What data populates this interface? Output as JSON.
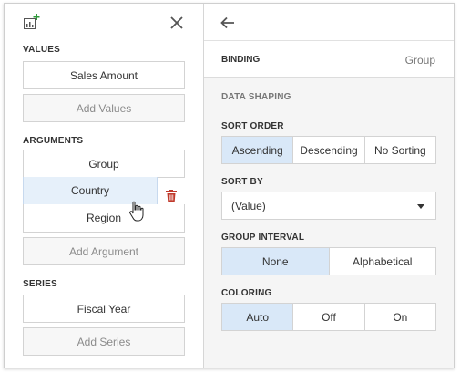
{
  "left": {
    "values_title": "VALUES",
    "values_item": "Sales Amount",
    "add_values": "Add Values",
    "arguments_title": "ARGUMENTS",
    "arguments": [
      "Group",
      "Country",
      "Region"
    ],
    "add_argument": "Add Argument",
    "series_title": "SERIES",
    "series_item": "Fiscal Year",
    "add_series": "Add Series"
  },
  "right": {
    "binding_label": "BINDING",
    "binding_value": "Group",
    "data_shaping": "DATA SHAPING",
    "sort_order_title": "SORT ORDER",
    "sort_order": [
      "Ascending",
      "Descending",
      "No Sorting"
    ],
    "sort_by_title": "SORT BY",
    "sort_by_value": "(Value)",
    "group_interval_title": "GROUP INTERVAL",
    "group_interval": [
      "None",
      "Alphabetical"
    ],
    "coloring_title": "COLORING",
    "coloring": [
      "Auto",
      "Off",
      "On"
    ]
  },
  "colors": {
    "accent_green": "#2e9a3a",
    "trash_red": "#c0392b",
    "active_segment": "#d9e8f8"
  },
  "icons": [
    "add-chart-icon",
    "close-icon",
    "trash-icon",
    "hand-cursor-icon",
    "back-arrow-icon",
    "dropdown-caret-icon"
  ]
}
